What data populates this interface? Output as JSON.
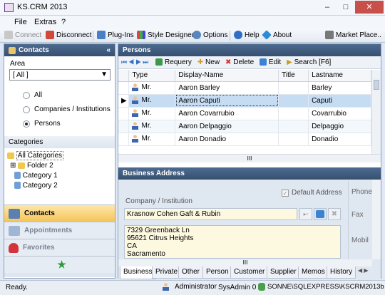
{
  "window": {
    "title": "KS.CRM 2013",
    "minimize": "–",
    "maximize": "□",
    "close": "✕"
  },
  "menu": [
    "File",
    "Extras",
    "?"
  ],
  "toolbar": {
    "connect": "Connect",
    "disconnect": "Disconnect",
    "plugins": "Plug-Ins",
    "style_designer": "Style Designer",
    "options": "Options",
    "help": "Help",
    "about": "About",
    "market_place": "Market Place.."
  },
  "contacts_panel": {
    "title": "Contacts",
    "area_label": "Area",
    "area_value": "[ All ]",
    "radios": [
      {
        "label": "All",
        "checked": false
      },
      {
        "label": "Companies / Institutions",
        "checked": false
      },
      {
        "label": "Persons",
        "checked": true
      }
    ]
  },
  "categories": {
    "title": "Categories",
    "items": [
      "All Categories",
      "Folder 2",
      "Category 1",
      "Category 2"
    ]
  },
  "nav": [
    "Contacts",
    "Appointments",
    "Favorites"
  ],
  "persons": {
    "title": "Persons",
    "toolbar": {
      "requery": "Requery",
      "new": "New",
      "delete": "Delete",
      "edit": "Edit",
      "search": "Search [F6]"
    },
    "columns": [
      "Type",
      "Display-Name",
      "Title",
      "Lastname"
    ],
    "rows": [
      {
        "type": "Mr.",
        "display": "Aaron Barley",
        "title": "",
        "lastname": "Barley"
      },
      {
        "type": "Mr.",
        "display": "Aaron Caputi",
        "title": "",
        "lastname": "Caputi"
      },
      {
        "type": "Mr.",
        "display": "Aaron Covarrubio",
        "title": "",
        "lastname": "Covarrubio"
      },
      {
        "type": "Mr.",
        "display": "Aaron Delpaggio",
        "title": "",
        "lastname": "Delpaggio"
      },
      {
        "type": "Mr.",
        "display": "Aaron Donadio",
        "title": "",
        "lastname": "Donadio"
      }
    ],
    "selected_row": 1,
    "hscroll_label": "III"
  },
  "business": {
    "title": "Business Address",
    "default_address": "Default Address",
    "company_label": "Company / Institution",
    "company_value": "Krasnow Cohen Gaft & Rubin",
    "address_lines": [
      "7329 Greenback Ln",
      "95621 Citrus Heights",
      "CA",
      "Sacramento"
    ],
    "phone_label": "Phone",
    "fax_label": "Fax",
    "mobile_label": "Mobil",
    "hscroll_label": "III"
  },
  "detail_tabs": [
    "Business",
    "Private",
    "Other",
    "Person",
    "Customer",
    "Supplier",
    "Memos",
    "History"
  ],
  "status": {
    "ready": "Ready.",
    "user": "Administrator",
    "sysadmin": "SysAdmin 0",
    "server": "SONNE\\SQLEXPRESS\\KSCRM2013b"
  },
  "colors": {
    "header": "#3f5b80",
    "selection": "#c6dcf3",
    "field": "#fdf9e1"
  }
}
